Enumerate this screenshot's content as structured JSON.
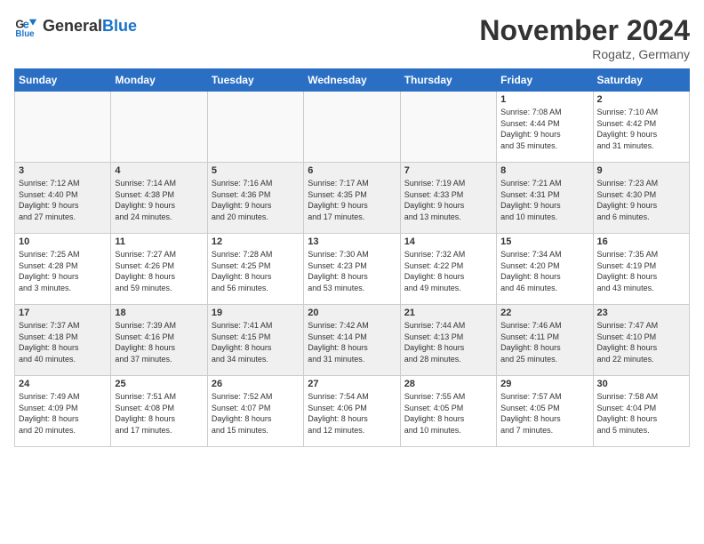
{
  "header": {
    "logo_line1": "General",
    "logo_line2": "Blue",
    "month": "November 2024",
    "location": "Rogatz, Germany"
  },
  "weekdays": [
    "Sunday",
    "Monday",
    "Tuesday",
    "Wednesday",
    "Thursday",
    "Friday",
    "Saturday"
  ],
  "weeks": [
    [
      {
        "day": "",
        "info": "",
        "empty": true
      },
      {
        "day": "",
        "info": "",
        "empty": true
      },
      {
        "day": "",
        "info": "",
        "empty": true
      },
      {
        "day": "",
        "info": "",
        "empty": true
      },
      {
        "day": "",
        "info": "",
        "empty": true
      },
      {
        "day": "1",
        "info": "Sunrise: 7:08 AM\nSunset: 4:44 PM\nDaylight: 9 hours\nand 35 minutes.",
        "shaded": false
      },
      {
        "day": "2",
        "info": "Sunrise: 7:10 AM\nSunset: 4:42 PM\nDaylight: 9 hours\nand 31 minutes.",
        "shaded": false
      }
    ],
    [
      {
        "day": "3",
        "info": "Sunrise: 7:12 AM\nSunset: 4:40 PM\nDaylight: 9 hours\nand 27 minutes.",
        "shaded": true
      },
      {
        "day": "4",
        "info": "Sunrise: 7:14 AM\nSunset: 4:38 PM\nDaylight: 9 hours\nand 24 minutes.",
        "shaded": true
      },
      {
        "day": "5",
        "info": "Sunrise: 7:16 AM\nSunset: 4:36 PM\nDaylight: 9 hours\nand 20 minutes.",
        "shaded": true
      },
      {
        "day": "6",
        "info": "Sunrise: 7:17 AM\nSunset: 4:35 PM\nDaylight: 9 hours\nand 17 minutes.",
        "shaded": true
      },
      {
        "day": "7",
        "info": "Sunrise: 7:19 AM\nSunset: 4:33 PM\nDaylight: 9 hours\nand 13 minutes.",
        "shaded": true
      },
      {
        "day": "8",
        "info": "Sunrise: 7:21 AM\nSunset: 4:31 PM\nDaylight: 9 hours\nand 10 minutes.",
        "shaded": true
      },
      {
        "day": "9",
        "info": "Sunrise: 7:23 AM\nSunset: 4:30 PM\nDaylight: 9 hours\nand 6 minutes.",
        "shaded": true
      }
    ],
    [
      {
        "day": "10",
        "info": "Sunrise: 7:25 AM\nSunset: 4:28 PM\nDaylight: 9 hours\nand 3 minutes.",
        "shaded": false
      },
      {
        "day": "11",
        "info": "Sunrise: 7:27 AM\nSunset: 4:26 PM\nDaylight: 8 hours\nand 59 minutes.",
        "shaded": false
      },
      {
        "day": "12",
        "info": "Sunrise: 7:28 AM\nSunset: 4:25 PM\nDaylight: 8 hours\nand 56 minutes.",
        "shaded": false
      },
      {
        "day": "13",
        "info": "Sunrise: 7:30 AM\nSunset: 4:23 PM\nDaylight: 8 hours\nand 53 minutes.",
        "shaded": false
      },
      {
        "day": "14",
        "info": "Sunrise: 7:32 AM\nSunset: 4:22 PM\nDaylight: 8 hours\nand 49 minutes.",
        "shaded": false
      },
      {
        "day": "15",
        "info": "Sunrise: 7:34 AM\nSunset: 4:20 PM\nDaylight: 8 hours\nand 46 minutes.",
        "shaded": false
      },
      {
        "day": "16",
        "info": "Sunrise: 7:35 AM\nSunset: 4:19 PM\nDaylight: 8 hours\nand 43 minutes.",
        "shaded": false
      }
    ],
    [
      {
        "day": "17",
        "info": "Sunrise: 7:37 AM\nSunset: 4:18 PM\nDaylight: 8 hours\nand 40 minutes.",
        "shaded": true
      },
      {
        "day": "18",
        "info": "Sunrise: 7:39 AM\nSunset: 4:16 PM\nDaylight: 8 hours\nand 37 minutes.",
        "shaded": true
      },
      {
        "day": "19",
        "info": "Sunrise: 7:41 AM\nSunset: 4:15 PM\nDaylight: 8 hours\nand 34 minutes.",
        "shaded": true
      },
      {
        "day": "20",
        "info": "Sunrise: 7:42 AM\nSunset: 4:14 PM\nDaylight: 8 hours\nand 31 minutes.",
        "shaded": true
      },
      {
        "day": "21",
        "info": "Sunrise: 7:44 AM\nSunset: 4:13 PM\nDaylight: 8 hours\nand 28 minutes.",
        "shaded": true
      },
      {
        "day": "22",
        "info": "Sunrise: 7:46 AM\nSunset: 4:11 PM\nDaylight: 8 hours\nand 25 minutes.",
        "shaded": true
      },
      {
        "day": "23",
        "info": "Sunrise: 7:47 AM\nSunset: 4:10 PM\nDaylight: 8 hours\nand 22 minutes.",
        "shaded": true
      }
    ],
    [
      {
        "day": "24",
        "info": "Sunrise: 7:49 AM\nSunset: 4:09 PM\nDaylight: 8 hours\nand 20 minutes.",
        "shaded": false
      },
      {
        "day": "25",
        "info": "Sunrise: 7:51 AM\nSunset: 4:08 PM\nDaylight: 8 hours\nand 17 minutes.",
        "shaded": false
      },
      {
        "day": "26",
        "info": "Sunrise: 7:52 AM\nSunset: 4:07 PM\nDaylight: 8 hours\nand 15 minutes.",
        "shaded": false
      },
      {
        "day": "27",
        "info": "Sunrise: 7:54 AM\nSunset: 4:06 PM\nDaylight: 8 hours\nand 12 minutes.",
        "shaded": false
      },
      {
        "day": "28",
        "info": "Sunrise: 7:55 AM\nSunset: 4:05 PM\nDaylight: 8 hours\nand 10 minutes.",
        "shaded": false
      },
      {
        "day": "29",
        "info": "Sunrise: 7:57 AM\nSunset: 4:05 PM\nDaylight: 8 hours\nand 7 minutes.",
        "shaded": false
      },
      {
        "day": "30",
        "info": "Sunrise: 7:58 AM\nSunset: 4:04 PM\nDaylight: 8 hours\nand 5 minutes.",
        "shaded": false
      }
    ]
  ]
}
